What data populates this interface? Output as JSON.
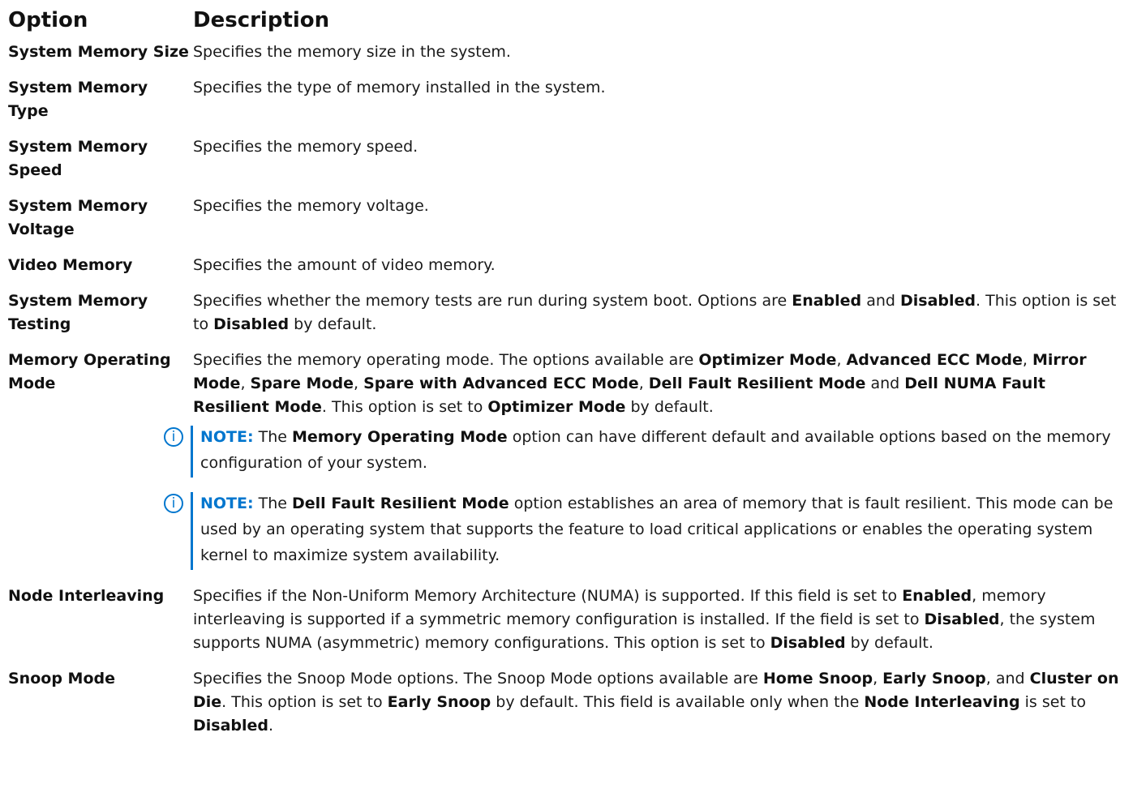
{
  "header": {
    "option": "Option",
    "description": "Description"
  },
  "rows": [
    {
      "option": "System Memory Size",
      "description": "Specifies the memory size in the system."
    },
    {
      "option": "System Memory Type",
      "description": "Specifies the type of memory installed in the system."
    },
    {
      "option": "System Memory Speed",
      "description": "Specifies the memory speed."
    },
    {
      "option": "System Memory Voltage",
      "description": "Specifies the memory voltage."
    },
    {
      "option": "Video Memory",
      "description": "Specifies the amount of video memory."
    },
    {
      "option": "System Memory Testing"
    },
    {
      "option": "Memory Operating Mode"
    },
    {
      "option": "Node Interleaving"
    },
    {
      "option": "Snoop Mode"
    }
  ],
  "testing": {
    "t1": "Specifies whether the memory tests are run during system boot. Options are ",
    "b1": "Enabled",
    "t2": " and ",
    "b2": "Disabled",
    "t3": ". This option is set to ",
    "b3": "Disabled",
    "t4": " by default."
  },
  "opmode": {
    "t1": "Specifies the memory operating mode. The options available are ",
    "b1": "Optimizer Mode",
    "t2": ", ",
    "b2": "Advanced ECC Mode",
    "t3": ", ",
    "b3": "Mirror Mode",
    "t4": ", ",
    "b4": "Spare Mode",
    "t5": ", ",
    "b5": "Spare with Advanced ECC Mode",
    "t6": ", ",
    "b6": "Dell Fault Resilient Mode",
    "t7": " and ",
    "b7": "Dell NUMA Fault Resilient Mode",
    "t8": ". This option is set to ",
    "b8": "Optimizer Mode",
    "t9": " by default.",
    "note1": {
      "label": "NOTE:",
      "t1": " The ",
      "b1": "Memory Operating Mode",
      "t2": " option can have different default and available options based on the memory configuration of your system."
    },
    "note2": {
      "label": "NOTE:",
      "t1": " The ",
      "b1": "Dell Fault Resilient Mode",
      "t2": " option establishes an area of memory that is fault resilient. This mode can be used by an operating system that supports the feature to load critical applications or enables the operating system kernel to maximize system availability."
    }
  },
  "interleave": {
    "t1": "Specifies if the Non-Uniform Memory Architecture (NUMA) is supported. If this field is set to ",
    "b1": "Enabled",
    "t2": ", memory interleaving is supported if a symmetric memory configuration is installed. If the field is set to ",
    "b2": "Disabled",
    "t3": ", the system supports NUMA (asymmetric) memory configurations. This option is set to ",
    "b3": "Disabled",
    "t4": " by default."
  },
  "snoop": {
    "t1": "Specifies the Snoop Mode options. The Snoop Mode options available are ",
    "b1": "Home Snoop",
    "t2": ", ",
    "b2": "Early Snoop",
    "t3": ", and ",
    "b3": "Cluster on Die",
    "t4": ". This option is set to ",
    "b4": "Early Snoop",
    "t5": " by default. This field is available only when the ",
    "b5": "Node Interleaving",
    "t6": " is set to ",
    "b6": "Disabled",
    "t7": "."
  }
}
